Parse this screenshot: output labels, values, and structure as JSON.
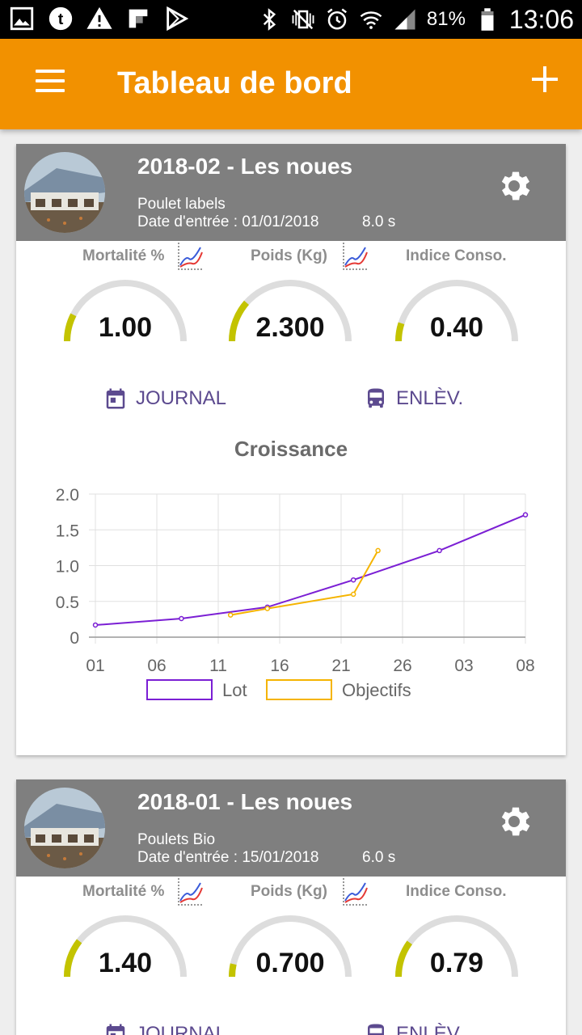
{
  "status_bar": {
    "battery": "81%",
    "time": "13:06",
    "left_icons": [
      "gallery-icon",
      "tumblr-icon",
      "warning-icon",
      "flipboard-icon",
      "play-store-icon"
    ],
    "right_icons": [
      "bluetooth-icon",
      "vibrate-icon",
      "alarm-icon",
      "wifi-icon",
      "signal-icon",
      "battery-icon"
    ]
  },
  "appbar": {
    "title": "Tableau de bord",
    "menu_icon": "menu-icon",
    "add_icon": "add-icon"
  },
  "colors": {
    "appbar": "#f29100",
    "card_header": "#7f7f7f",
    "gauge_fill": "#c3c300",
    "gauge_track": "#dddddd",
    "action": "#5c4a8f",
    "series_lot": "#7b1fd4",
    "series_objectifs": "#f5b400"
  },
  "labels": {
    "mortalite": "Mortalité %",
    "poids": "Poids (Kg)",
    "indice": "Indice Conso.",
    "journal": "JOURNAL",
    "enlev": "ENLÈV."
  },
  "cards": [
    {
      "title": "2018-02 - Les noues",
      "type": "Poulet labels",
      "date": "Date d'entrée : 01/01/2018",
      "age": "8.0 s",
      "gauges": [
        {
          "value": "1.00",
          "fill": 0.15
        },
        {
          "value": "2.300",
          "fill": 0.23
        },
        {
          "value": "0.40",
          "fill": 0.1
        }
      ],
      "chart_title": "Croissance"
    },
    {
      "title": "2018-01 - Les noues",
      "type": "Poulets Bio",
      "date": "Date d'entrée : 15/01/2018",
      "age": "6.0 s",
      "gauges": [
        {
          "value": "1.40",
          "fill": 0.21
        },
        {
          "value": "0.700",
          "fill": 0.07
        },
        {
          "value": "0.79",
          "fill": 0.2
        }
      ]
    }
  ],
  "chart_data": {
    "type": "line",
    "title": "Croissance",
    "xlabel": "",
    "ylabel": "",
    "x_ticks": [
      "01",
      "06",
      "11",
      "16",
      "21",
      "26",
      "03",
      "08"
    ],
    "y_ticks": [
      "0",
      "0.5",
      "1.0",
      "1.5",
      "2.0"
    ],
    "ylim": [
      0,
      2.0
    ],
    "xlim": [
      0,
      35
    ],
    "grid": true,
    "legend": "bottom",
    "series": [
      {
        "name": "Lot",
        "x": [
          0,
          7,
          14,
          21,
          28,
          35
        ],
        "y": [
          0.17,
          0.26,
          0.42,
          0.8,
          1.21,
          1.71
        ]
      },
      {
        "name": "Objectifs",
        "x": [
          11,
          14,
          21,
          23
        ],
        "y": [
          0.31,
          0.4,
          0.6,
          1.21
        ]
      }
    ]
  }
}
